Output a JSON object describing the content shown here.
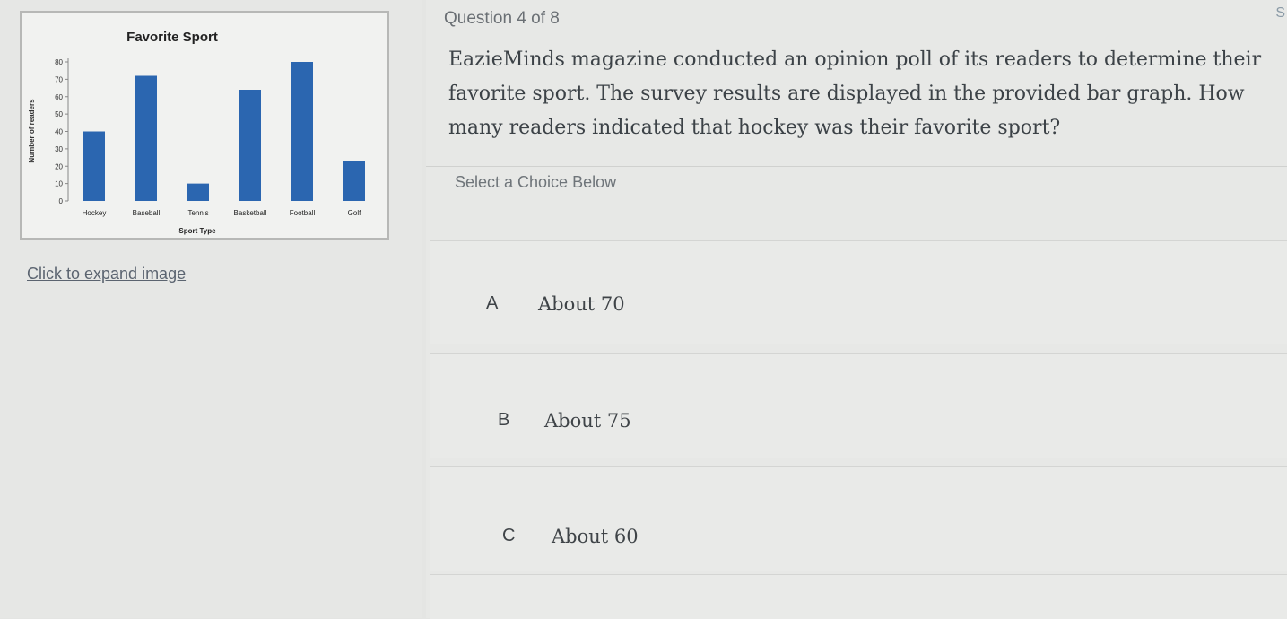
{
  "chart_data": {
    "type": "bar",
    "title": "Favorite Sport",
    "xlabel": "Sport Type",
    "ylabel": "Number of readers",
    "categories": [
      "Hockey",
      "Baseball",
      "Tennis",
      "Basketball",
      "Football",
      "Golf"
    ],
    "values": [
      40,
      72,
      10,
      64,
      80,
      23
    ],
    "yticks": [
      "80",
      "70",
      "60",
      "50",
      "40",
      "30",
      "20",
      "10",
      "0"
    ],
    "ylim": [
      0,
      80
    ],
    "bar_color": "#2b66b0",
    "grid": false,
    "legend": "none"
  },
  "expand_link": "Click to expand image",
  "question": {
    "number_label": "Question 4 of 8",
    "corner_mark": "S",
    "text": "EazieMinds magazine conducted an opinion poll of its readers to determine their favorite sport. The survey results are displayed in the provided bar graph. How many readers indicated that hockey was their favorite sport?",
    "select_hint": "Select a Choice Below"
  },
  "choices": [
    {
      "letter": "A",
      "text": "About 70"
    },
    {
      "letter": "B",
      "text": "About 75"
    },
    {
      "letter": "C",
      "text": "About 60"
    }
  ]
}
